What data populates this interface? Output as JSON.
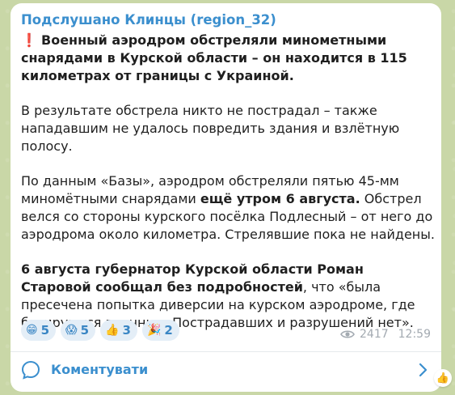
{
  "channel": {
    "name": "Подслушано Клинцы (region_32)"
  },
  "post": {
    "headline_icon": "❗",
    "headline": "Военный аэродром обстреляли минометными снарядами в Курской области – он находится в 115 километрах от границы с Украиной.",
    "p1": "В результате обстрела никто не пострадал – также нападавшим не удалось повредить здания и взлётную полосу.",
    "p2_a": "По данным «Базы», аэродром обстреляли пятью 45-мм миномётными снарядами ",
    "p2_b": "ещё утром 6 августа.",
    "p2_c": " Обстрел велся со стороны курского посёлка Подлесный – от него до аэродрома около километра. Стрелявшие пока не найдены.",
    "p3_a": "6 августа губернатор Курской области Роман Старовой сообщал без подробностей",
    "p3_b": ", что «была пресечена попытка диверсии на курском аэродроме, где базируются военные. Пострадавших и разрушений нет»."
  },
  "reactions": [
    {
      "emoji": "😁",
      "icon": "grinning-face-icon",
      "count": "5"
    },
    {
      "emoji": "😱",
      "icon": "screaming-face-icon",
      "count": "5"
    },
    {
      "emoji": "👍",
      "icon": "thumbs-up-icon",
      "count": "3"
    },
    {
      "emoji": "🎉",
      "icon": "party-popper-icon",
      "count": "2"
    }
  ],
  "meta": {
    "views": "2417",
    "time": "12:59"
  },
  "comments": {
    "label": "Коментувати"
  },
  "side_reaction": {
    "emoji": "👍"
  },
  "colors": {
    "accent": "#3b8fce",
    "reaction_bg": "#e4eef7",
    "chat_bg": "#c9d7a7"
  }
}
